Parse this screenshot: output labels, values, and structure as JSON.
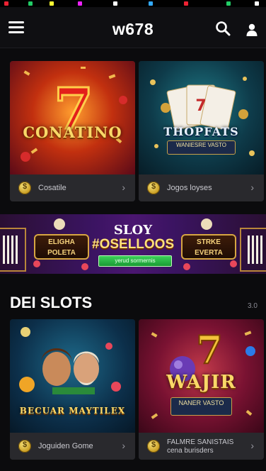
{
  "header": {
    "logo": "w678",
    "menu_icon": "hamburger-menu-icon",
    "search_icon": "search-icon",
    "user_icon": "user-icon"
  },
  "top_games": [
    {
      "art_title": "CONATINO",
      "label": "Cosatile"
    },
    {
      "art_title": "THOPFATS",
      "art_subtitle": "WANIESRE VASTO",
      "label": "Jogos loyses"
    }
  ],
  "promo_banner": {
    "left_sign": "ELIGHA POLETA",
    "title_top": "SLOY",
    "title_main": "#OSELLOOS",
    "cta": "yerud sormernis",
    "right_sign": "STRKE EVERTA"
  },
  "section": {
    "title": "DEI SLOTS",
    "count": "3.0"
  },
  "slot_games": [
    {
      "art_title": "BECUAR MAYTILEX",
      "label": "Joguiden Gome"
    },
    {
      "art_title": "WAJIR",
      "art_subtitle": "NANER VASTO",
      "label": "FALMRE SANISTAIS\ncena burisders"
    }
  ],
  "colors": {
    "background": "#0b0b0d",
    "card_footer": "#29292d",
    "gold": "#f9d868",
    "cta_green": "#1a9a34"
  }
}
